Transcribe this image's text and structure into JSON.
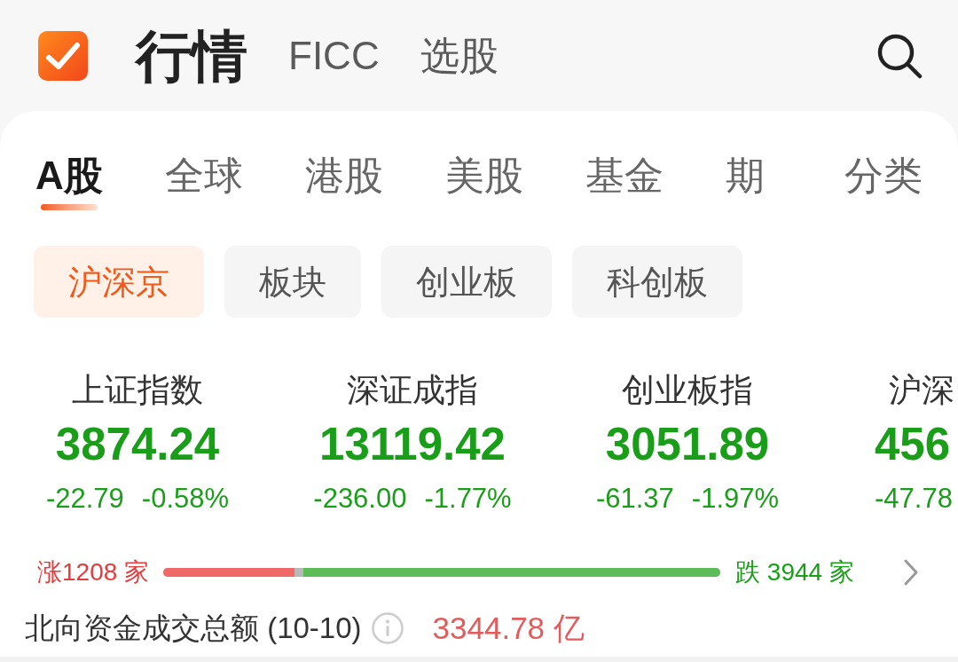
{
  "header": {
    "title": "行情",
    "tabs": [
      {
        "label": "FICC"
      },
      {
        "label": "选股"
      }
    ]
  },
  "market_tabs": [
    {
      "label": "A股",
      "selected": true
    },
    {
      "label": "全球",
      "selected": false
    },
    {
      "label": "港股",
      "selected": false
    },
    {
      "label": "美股",
      "selected": false
    },
    {
      "label": "基金",
      "selected": false
    },
    {
      "label": "期",
      "selected": false
    }
  ],
  "category_button": {
    "label": "分类"
  },
  "sub_tabs": [
    {
      "label": "沪深京",
      "selected": true
    },
    {
      "label": "板块",
      "selected": false
    },
    {
      "label": "创业板",
      "selected": false
    },
    {
      "label": "科创板",
      "selected": false
    }
  ],
  "indices": [
    {
      "name": "上证指数",
      "value": "3874.24",
      "change": "-22.79",
      "change_pct": "-0.58%"
    },
    {
      "name": "深证成指",
      "value": "13119.42",
      "change": "-236.00",
      "change_pct": "-1.77%"
    },
    {
      "name": "创业板指",
      "value": "3051.89",
      "change": "-61.37",
      "change_pct": "-1.97%"
    },
    {
      "name": "沪深",
      "value": "456",
      "change": "-47.78"
    }
  ],
  "breadth": {
    "up_label": "涨1208 家",
    "down_label": "跌 3944 家",
    "segments": [
      {
        "kind": "up",
        "level": 0.236
      },
      {
        "kind": "down",
        "level": 0.748
      }
    ]
  },
  "northbound": {
    "label": "北向资金成交总额 (10-10)",
    "value": "3344.78 亿"
  }
}
